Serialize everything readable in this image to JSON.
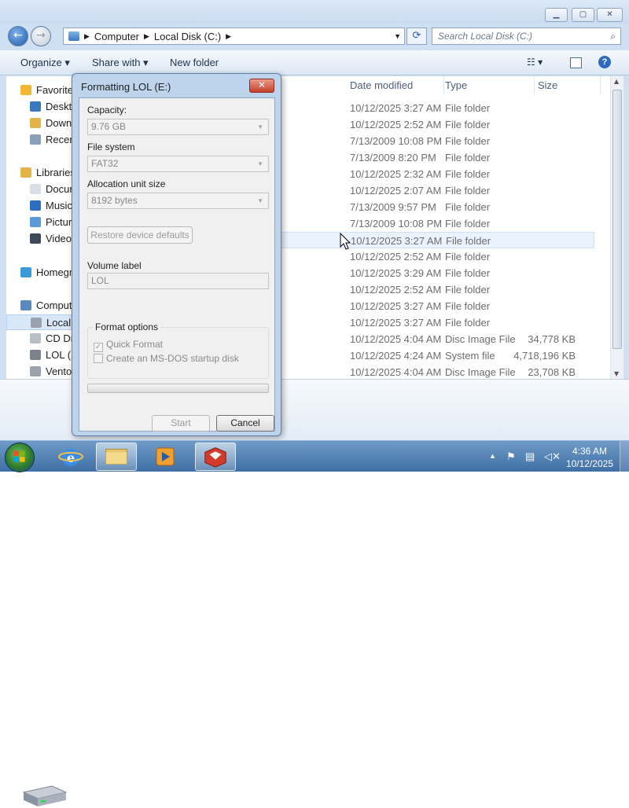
{
  "explorer": {
    "address": {
      "part1": "Computer",
      "part2": "Local Disk (C:)"
    },
    "search_placeholder": "Search Local Disk (C:)",
    "toolbar": {
      "organize": "Organize",
      "share_with": "Share with",
      "new_folder": "New folder"
    },
    "nav": [
      {
        "label": "Favorites",
        "icon": "star-icon"
      },
      {
        "label": "Desktop",
        "icon": "desktop-icon"
      },
      {
        "label": "Downloads",
        "icon": "downloads-icon"
      },
      {
        "label": "Recent Places",
        "icon": "recent-icon"
      },
      {
        "label": "Libraries",
        "icon": "libraries-icon"
      },
      {
        "label": "Documents",
        "icon": "documents-icon"
      },
      {
        "label": "Music",
        "icon": "music-icon"
      },
      {
        "label": "Pictures",
        "icon": "pictures-icon"
      },
      {
        "label": "Videos",
        "icon": "videos-icon"
      },
      {
        "label": "Homegroup",
        "icon": "homegroup-icon"
      },
      {
        "label": "Computer",
        "icon": "computer-icon"
      },
      {
        "label": "Local Disk (C:)",
        "icon": "drive-icon"
      },
      {
        "label": "CD Drive",
        "icon": "cd-drive-icon"
      },
      {
        "label": "LOL (E:)",
        "icon": "usb-drive-icon"
      },
      {
        "label": "Ventoy",
        "icon": "drive-icon"
      }
    ],
    "columns": {
      "date": "Date modified",
      "type": "Type",
      "size": "Size"
    },
    "rows": [
      {
        "date": "10/12/2025 3:27 AM",
        "type": "File folder",
        "size": ""
      },
      {
        "date": "10/12/2025 2:52 AM",
        "type": "File folder",
        "size": ""
      },
      {
        "date": "7/13/2009 10:08 PM",
        "type": "File folder",
        "size": ""
      },
      {
        "date": "7/13/2009 8:20 PM",
        "type": "File folder",
        "size": ""
      },
      {
        "date": "10/12/2025 2:32 AM",
        "type": "File folder",
        "size": ""
      },
      {
        "date": "10/12/2025 2:07 AM",
        "type": "File folder",
        "size": ""
      },
      {
        "date": "7/13/2009 9:57 PM",
        "type": "File folder",
        "size": ""
      },
      {
        "date": "7/13/2009 10:08 PM",
        "type": "File folder",
        "size": ""
      },
      {
        "date": "10/12/2025 3:27 AM",
        "type": "File folder",
        "size": ""
      },
      {
        "date": "10/12/2025 2:52 AM",
        "type": "File folder",
        "size": ""
      },
      {
        "date": "10/12/2025 3:29 AM",
        "type": "File folder",
        "size": ""
      },
      {
        "date": "10/12/2025 2:52 AM",
        "type": "File folder",
        "size": ""
      },
      {
        "date": "10/12/2025 3:27 AM",
        "type": "File folder",
        "size": ""
      },
      {
        "date": "10/12/2025 3:27 AM",
        "type": "File folder",
        "size": ""
      },
      {
        "date": "10/12/2025 4:04 AM",
        "type": "Disc Image File",
        "size": "34,778 KB"
      },
      {
        "date": "10/12/2025 4:24 AM",
        "type": "System file",
        "size": "4,718,196 KB"
      },
      {
        "date": "10/12/2025 4:04 AM",
        "type": "Disc Image File",
        "size": "23,708 KB"
      }
    ]
  },
  "dialog": {
    "title": "Formatting LOL (E:)",
    "capacity_label": "Capacity:",
    "capacity_value": "9.76 GB",
    "filesystem_label": "File system",
    "filesystem_value": "FAT32",
    "alloc_label": "Allocation unit size",
    "alloc_value": "8192 bytes",
    "restore_button": "Restore device defaults",
    "volume_label": "Volume label",
    "volume_value": "LOL",
    "format_options": "Format options",
    "quick_format": "Quick Format",
    "quick_format_checked": true,
    "msdos": "Create an MS-DOS startup disk",
    "progress": 0,
    "start_button": "Start",
    "cancel_button": "Cancel"
  },
  "taskbar": {
    "time": "4:36 AM",
    "date": "10/12/2025"
  },
  "colors": {
    "accent": "#3f6fa5",
    "selection": "#eaf3fd",
    "close_red": "#c4402a"
  }
}
